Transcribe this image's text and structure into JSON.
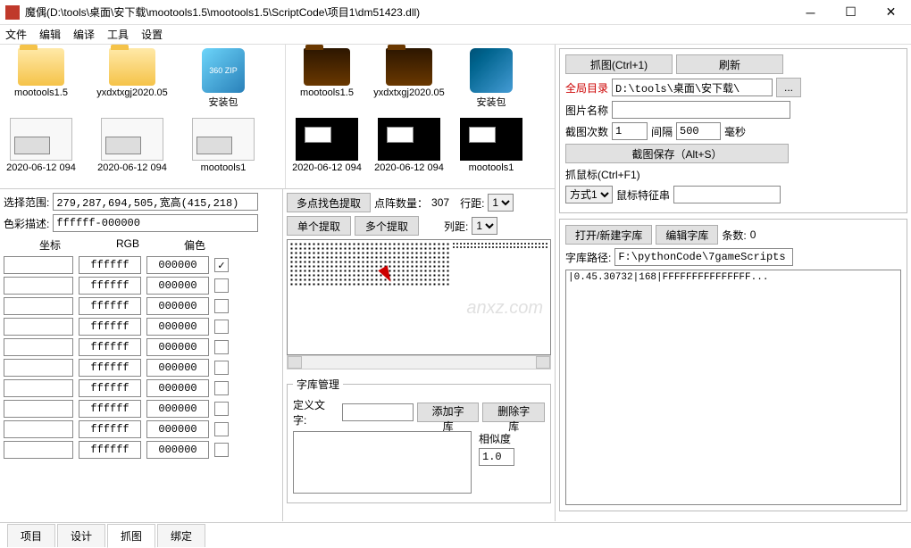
{
  "title": "魔偶(D:\\tools\\桌面\\安下载\\mootools1.5\\mootools1.5\\ScriptCode\\项目1\\dm51423.dll)",
  "menu": [
    "文件",
    "编辑",
    "编译",
    "工具",
    "设置"
  ],
  "folders_left": [
    {
      "name": "mootools1.5",
      "type": "folder"
    },
    {
      "name": "yxdxtxgj2020.05",
      "type": "folder"
    },
    {
      "name": "安装包",
      "type": "zip",
      "badge": "360\nZIP"
    },
    {
      "name": "2020-06-12 094",
      "type": "thumb"
    },
    {
      "name": "2020-06-12 094",
      "type": "thumb"
    },
    {
      "name": "mootools1",
      "type": "thumb"
    }
  ],
  "folders_right": [
    {
      "name": "mootools1.5",
      "type": "folder"
    },
    {
      "name": "yxdxtxgj2020.05",
      "type": "folder"
    },
    {
      "name": "安装包",
      "type": "zip"
    },
    {
      "name": "2020-06-12 094",
      "type": "dark"
    },
    {
      "name": "2020-06-12 094",
      "type": "dark"
    },
    {
      "name": "mootools1",
      "type": "dark"
    }
  ],
  "select_range": {
    "label": "选择范围:",
    "value": "279,287,694,505,宽高(415,218)"
  },
  "color_desc": {
    "label": "色彩描述:",
    "value": "ffffff-000000"
  },
  "color_headers": [
    "坐标",
    "RGB",
    "偏色"
  ],
  "color_rows": [
    {
      "coord": "",
      "rgb": "ffffff",
      "offset": "000000",
      "checked": true
    },
    {
      "coord": "",
      "rgb": "ffffff",
      "offset": "000000",
      "checked": false
    },
    {
      "coord": "",
      "rgb": "ffffff",
      "offset": "000000",
      "checked": false
    },
    {
      "coord": "",
      "rgb": "ffffff",
      "offset": "000000",
      "checked": false
    },
    {
      "coord": "",
      "rgb": "ffffff",
      "offset": "000000",
      "checked": false
    },
    {
      "coord": "",
      "rgb": "ffffff",
      "offset": "000000",
      "checked": false
    },
    {
      "coord": "",
      "rgb": "ffffff",
      "offset": "000000",
      "checked": false
    },
    {
      "coord": "",
      "rgb": "ffffff",
      "offset": "000000",
      "checked": false
    },
    {
      "coord": "",
      "rgb": "ffffff",
      "offset": "000000",
      "checked": false
    },
    {
      "coord": "",
      "rgb": "ffffff",
      "offset": "000000",
      "checked": false
    }
  ],
  "extract": {
    "multi_find": "多点找色提取",
    "single": "单个提取",
    "multi": "多个提取",
    "dot_count_label": "点阵数量：",
    "dot_count": "307",
    "row_label": "行距:",
    "row_val": "1",
    "col_label": "列距:",
    "col_val": "1"
  },
  "font_mgmt": {
    "legend": "字库管理",
    "define_label": "定义文字:",
    "add_btn": "添加字库",
    "del_btn": "删除字库",
    "sim_label": "相似度",
    "sim_val": "1.0"
  },
  "right": {
    "capture_btn": "抓图(Ctrl+1)",
    "refresh_btn": "刷新",
    "global_dir_label": "全局目录",
    "global_dir": "D:\\tools\\桌面\\安下载\\",
    "browse": "...",
    "img_name_label": "图片名称",
    "img_name": "",
    "count_label": "截图次数",
    "count": "1",
    "interval_label": "间隔",
    "interval": "500",
    "ms": "毫秒",
    "save_btn": "截图保存（Alt+S）",
    "mouse_label": "抓鼠标(Ctrl+F1)",
    "mode_val": "方式1",
    "mouse_feature_label": "鼠标特征串",
    "mouse_feature": "",
    "open_lib": "打开/新建字库",
    "edit_lib": "编辑字库",
    "rec_count_label": "条数:",
    "rec_count": "0",
    "lib_path_label": "字库路径:",
    "lib_path": "F:\\pythonCode\\7gameScripts",
    "list_item": "|0.45.30732|168|FFFFFFFFFFFFFFF..."
  },
  "tabs": [
    "项目",
    "设计",
    "抓图",
    "绑定"
  ],
  "active_tab": 2,
  "watermark": "anxz.com"
}
